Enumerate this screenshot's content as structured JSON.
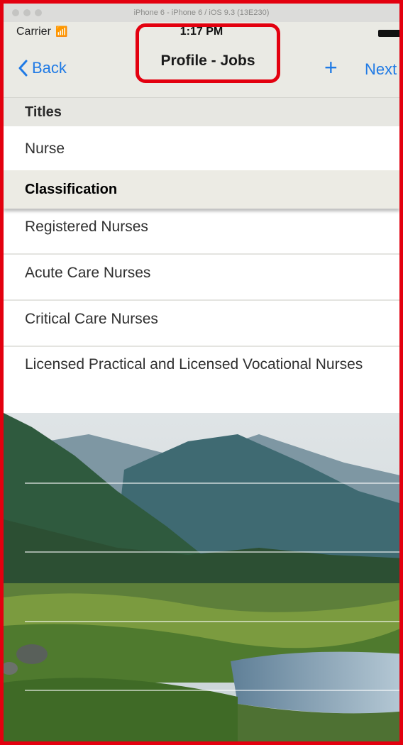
{
  "simulator": {
    "title": "iPhone 6 - iPhone 6 / iOS 9.3 (13E230)"
  },
  "status_bar": {
    "carrier": "Carrier",
    "time": "1:17 PM"
  },
  "nav_bar": {
    "back_label": "Back",
    "title": "Profile - Jobs",
    "add_label": "+",
    "next_label": "Next"
  },
  "sections": {
    "titles": {
      "header": "Titles",
      "items": [
        "Nurse"
      ]
    },
    "classification": {
      "header": "Classification",
      "items": [
        "Registered Nurses",
        "Acute Care Nurses",
        "Critical Care Nurses",
        "Licensed Practical and Licensed Vocational Nurses"
      ]
    }
  },
  "colors": {
    "accent": "#1f7ae5",
    "highlight": "#e3000f",
    "header_bg": "#e7e7e2",
    "nav_bg": "#eaeae4"
  }
}
